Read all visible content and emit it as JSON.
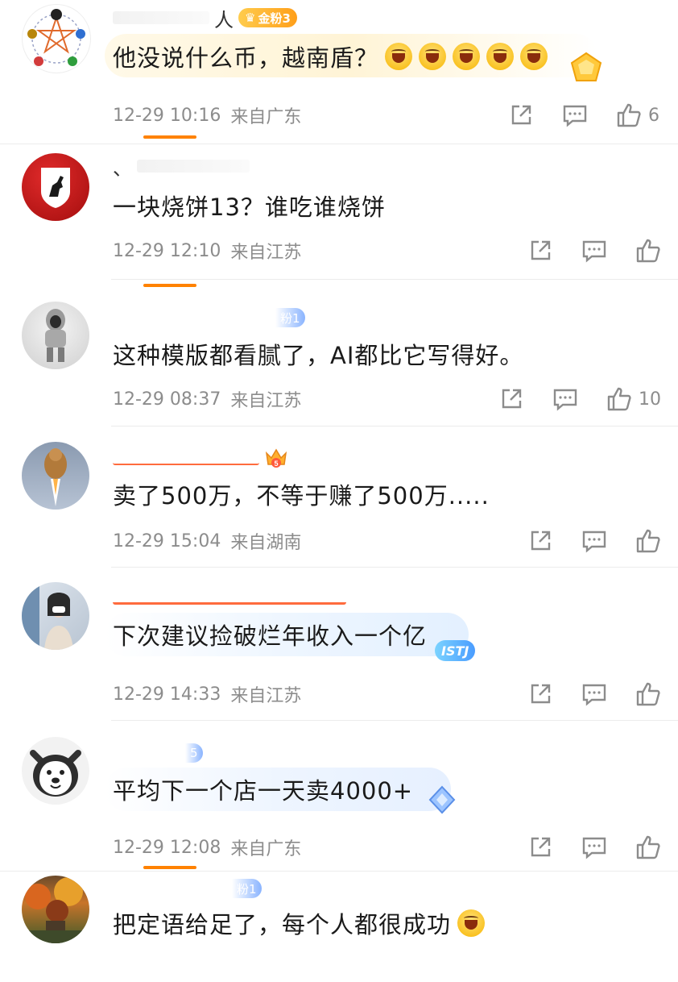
{
  "comments": [
    {
      "user_tail": "人",
      "badge": "金粉3",
      "text": "他没说什么币，越南盾？",
      "time": "12-29 10:16",
      "location": "来自广东",
      "likes": "6"
    },
    {
      "user_tail": "、",
      "text": "一块烧饼13？谁吃谁烧饼",
      "time": "12-29 12:10",
      "location": "来自江苏",
      "likes": ""
    },
    {
      "badge": "粉1",
      "text": "这种模版都看腻了，AI都比它写得好。",
      "time": "12-29 08:37",
      "location": "来自江苏",
      "likes": "10"
    },
    {
      "badge_num": "5",
      "text": "卖了500万，不等于赚了500万.....",
      "time": "12-29 15:04",
      "location": "来自湖南",
      "likes": ""
    },
    {
      "text": "下次建议捡破烂年收入一个亿",
      "deco_text": "ISTJ",
      "time": "12-29 14:33",
      "location": "来自江苏",
      "likes": ""
    },
    {
      "badge": "5",
      "text": "平均下一个店一天卖4000+",
      "time": "12-29 12:08",
      "location": "来自广东",
      "likes": ""
    },
    {
      "badge": "粉1",
      "text": "把定语给足了，每个人都很成功",
      "time": "",
      "location": "",
      "likes": ""
    }
  ],
  "colors": {
    "accent": "#ff8200",
    "meta": "#8c8c8c",
    "divider": "#ececec"
  }
}
